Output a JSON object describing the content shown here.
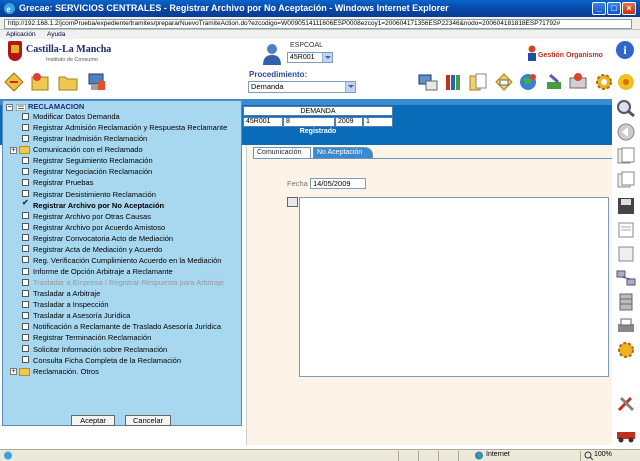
{
  "window": {
    "title": "Grecae: SERVICIOS CENTRALES - Registrar Archivo por No Aceptación - Windows Internet Explorer",
    "url": "http://192.168.1.2/jcomPrueba/expediente/tramites/prepararNuevoTramiteAction.do?ezcodigo=W0090514111606ESP0008ezcoy1=200604171356ESP22346&nodo=200604181818ESP71792#"
  },
  "app_menu": {
    "items": [
      "Aplicación",
      "Ayuda"
    ]
  },
  "header": {
    "logo_name": "Castilla-La Mancha",
    "logo_sub": "Instituto de Consumo",
    "user_label": "ESPCOAL",
    "user_value": "45R001",
    "gestion": "Gestión Organismo",
    "info_symbol": "i"
  },
  "toolbar": {
    "procedimiento_label": "Procedimiento:",
    "procedimiento_value": "Demanda"
  },
  "demanda": {
    "header": "DEMANDA",
    "cells": [
      "45R001",
      "8",
      "2009",
      "1"
    ],
    "status": "Registrado"
  },
  "tabs": [
    "Comunicación",
    "No Aceptación"
  ],
  "form": {
    "fecha_label": "Fecha",
    "fecha_value": "14/05/2009"
  },
  "dropdown": {
    "root": "RECLAMACION",
    "items": [
      {
        "label": "Modificar Datos Demanda",
        "type": "item"
      },
      {
        "label": "Registrar Admisión Reclamación y Respuesta Reclamante",
        "type": "item"
      },
      {
        "label": "Registrar Inadmisión Reclamación",
        "type": "item"
      },
      {
        "label": "Comunicación con el Reclamado",
        "type": "folder"
      },
      {
        "label": "Registrar Seguimiento Reclamación",
        "type": "item"
      },
      {
        "label": "Registrar Negociación Reclamación",
        "type": "item"
      },
      {
        "label": "Registrar Pruebas",
        "type": "item"
      },
      {
        "label": "Registrar Desistimiento Reclamación",
        "type": "item"
      },
      {
        "label": "Registrar Archivo por No Aceptación",
        "type": "checked"
      },
      {
        "label": "Registrar Archivo por Otras Causas",
        "type": "item"
      },
      {
        "label": "Registrar Archivo por Acuerdo Amistoso",
        "type": "item"
      },
      {
        "label": "Registrar Convocatoria Acto de Mediación",
        "type": "item"
      },
      {
        "label": "Registrar Acta de Mediación y Acuerdo",
        "type": "item"
      },
      {
        "label": "Reg. Verificación Cumplimiento Acuerdo en la Mediación",
        "type": "item"
      },
      {
        "label": "Informe de Opción Arbitraje a Reclamante",
        "type": "item"
      },
      {
        "label": "Trasladar a Empresa / Registrar Respuesta para Arbitraje",
        "type": "disabled"
      },
      {
        "label": "Trasladar a Arbitraje",
        "type": "item"
      },
      {
        "label": "Trasladar a Inspección",
        "type": "item"
      },
      {
        "label": "Trasladar a Asesoría Jurídica",
        "type": "item"
      },
      {
        "label": "Notificación a Reclamante de Traslado Asesoría Jurídica",
        "type": "item"
      },
      {
        "label": "Registrar Terminación Reclamación",
        "type": "item"
      },
      {
        "label": "Solicitar Información sobre Reclamación",
        "type": "item"
      },
      {
        "label": "Consulta Ficha Completa de la Reclamación",
        "type": "item"
      },
      {
        "label": "Reclamación. Otros",
        "type": "folder"
      }
    ],
    "accept": "Aceptar",
    "cancel": "Cancelar"
  },
  "status": {
    "zone": "Internet",
    "zoom": "100%"
  }
}
